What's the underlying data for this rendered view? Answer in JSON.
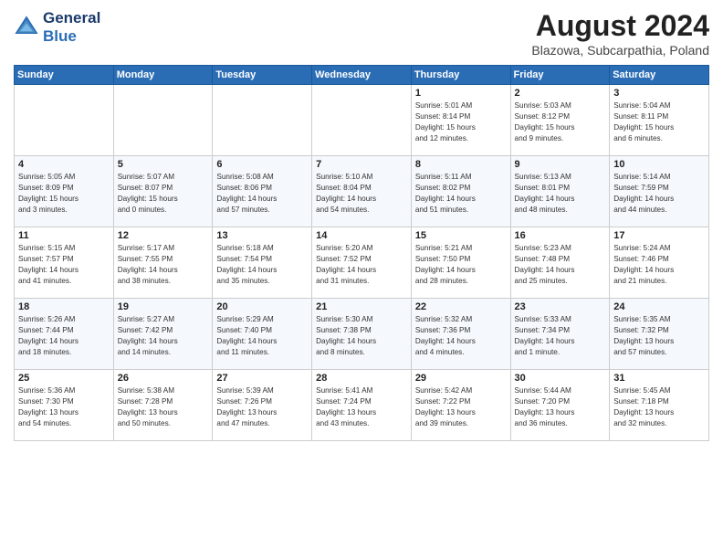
{
  "logo": {
    "line1": "General",
    "line2": "Blue"
  },
  "title": "August 2024",
  "subtitle": "Blazowa, Subcarpathia, Poland",
  "days_of_week": [
    "Sunday",
    "Monday",
    "Tuesday",
    "Wednesday",
    "Thursday",
    "Friday",
    "Saturday"
  ],
  "weeks": [
    [
      {
        "day": "",
        "info": ""
      },
      {
        "day": "",
        "info": ""
      },
      {
        "day": "",
        "info": ""
      },
      {
        "day": "",
        "info": ""
      },
      {
        "day": "1",
        "info": "Sunrise: 5:01 AM\nSunset: 8:14 PM\nDaylight: 15 hours\nand 12 minutes."
      },
      {
        "day": "2",
        "info": "Sunrise: 5:03 AM\nSunset: 8:12 PM\nDaylight: 15 hours\nand 9 minutes."
      },
      {
        "day": "3",
        "info": "Sunrise: 5:04 AM\nSunset: 8:11 PM\nDaylight: 15 hours\nand 6 minutes."
      }
    ],
    [
      {
        "day": "4",
        "info": "Sunrise: 5:05 AM\nSunset: 8:09 PM\nDaylight: 15 hours\nand 3 minutes."
      },
      {
        "day": "5",
        "info": "Sunrise: 5:07 AM\nSunset: 8:07 PM\nDaylight: 15 hours\nand 0 minutes."
      },
      {
        "day": "6",
        "info": "Sunrise: 5:08 AM\nSunset: 8:06 PM\nDaylight: 14 hours\nand 57 minutes."
      },
      {
        "day": "7",
        "info": "Sunrise: 5:10 AM\nSunset: 8:04 PM\nDaylight: 14 hours\nand 54 minutes."
      },
      {
        "day": "8",
        "info": "Sunrise: 5:11 AM\nSunset: 8:02 PM\nDaylight: 14 hours\nand 51 minutes."
      },
      {
        "day": "9",
        "info": "Sunrise: 5:13 AM\nSunset: 8:01 PM\nDaylight: 14 hours\nand 48 minutes."
      },
      {
        "day": "10",
        "info": "Sunrise: 5:14 AM\nSunset: 7:59 PM\nDaylight: 14 hours\nand 44 minutes."
      }
    ],
    [
      {
        "day": "11",
        "info": "Sunrise: 5:15 AM\nSunset: 7:57 PM\nDaylight: 14 hours\nand 41 minutes."
      },
      {
        "day": "12",
        "info": "Sunrise: 5:17 AM\nSunset: 7:55 PM\nDaylight: 14 hours\nand 38 minutes."
      },
      {
        "day": "13",
        "info": "Sunrise: 5:18 AM\nSunset: 7:54 PM\nDaylight: 14 hours\nand 35 minutes."
      },
      {
        "day": "14",
        "info": "Sunrise: 5:20 AM\nSunset: 7:52 PM\nDaylight: 14 hours\nand 31 minutes."
      },
      {
        "day": "15",
        "info": "Sunrise: 5:21 AM\nSunset: 7:50 PM\nDaylight: 14 hours\nand 28 minutes."
      },
      {
        "day": "16",
        "info": "Sunrise: 5:23 AM\nSunset: 7:48 PM\nDaylight: 14 hours\nand 25 minutes."
      },
      {
        "day": "17",
        "info": "Sunrise: 5:24 AM\nSunset: 7:46 PM\nDaylight: 14 hours\nand 21 minutes."
      }
    ],
    [
      {
        "day": "18",
        "info": "Sunrise: 5:26 AM\nSunset: 7:44 PM\nDaylight: 14 hours\nand 18 minutes."
      },
      {
        "day": "19",
        "info": "Sunrise: 5:27 AM\nSunset: 7:42 PM\nDaylight: 14 hours\nand 14 minutes."
      },
      {
        "day": "20",
        "info": "Sunrise: 5:29 AM\nSunset: 7:40 PM\nDaylight: 14 hours\nand 11 minutes."
      },
      {
        "day": "21",
        "info": "Sunrise: 5:30 AM\nSunset: 7:38 PM\nDaylight: 14 hours\nand 8 minutes."
      },
      {
        "day": "22",
        "info": "Sunrise: 5:32 AM\nSunset: 7:36 PM\nDaylight: 14 hours\nand 4 minutes."
      },
      {
        "day": "23",
        "info": "Sunrise: 5:33 AM\nSunset: 7:34 PM\nDaylight: 14 hours\nand 1 minute."
      },
      {
        "day": "24",
        "info": "Sunrise: 5:35 AM\nSunset: 7:32 PM\nDaylight: 13 hours\nand 57 minutes."
      }
    ],
    [
      {
        "day": "25",
        "info": "Sunrise: 5:36 AM\nSunset: 7:30 PM\nDaylight: 13 hours\nand 54 minutes."
      },
      {
        "day": "26",
        "info": "Sunrise: 5:38 AM\nSunset: 7:28 PM\nDaylight: 13 hours\nand 50 minutes."
      },
      {
        "day": "27",
        "info": "Sunrise: 5:39 AM\nSunset: 7:26 PM\nDaylight: 13 hours\nand 47 minutes."
      },
      {
        "day": "28",
        "info": "Sunrise: 5:41 AM\nSunset: 7:24 PM\nDaylight: 13 hours\nand 43 minutes."
      },
      {
        "day": "29",
        "info": "Sunrise: 5:42 AM\nSunset: 7:22 PM\nDaylight: 13 hours\nand 39 minutes."
      },
      {
        "day": "30",
        "info": "Sunrise: 5:44 AM\nSunset: 7:20 PM\nDaylight: 13 hours\nand 36 minutes."
      },
      {
        "day": "31",
        "info": "Sunrise: 5:45 AM\nSunset: 7:18 PM\nDaylight: 13 hours\nand 32 minutes."
      }
    ]
  ]
}
